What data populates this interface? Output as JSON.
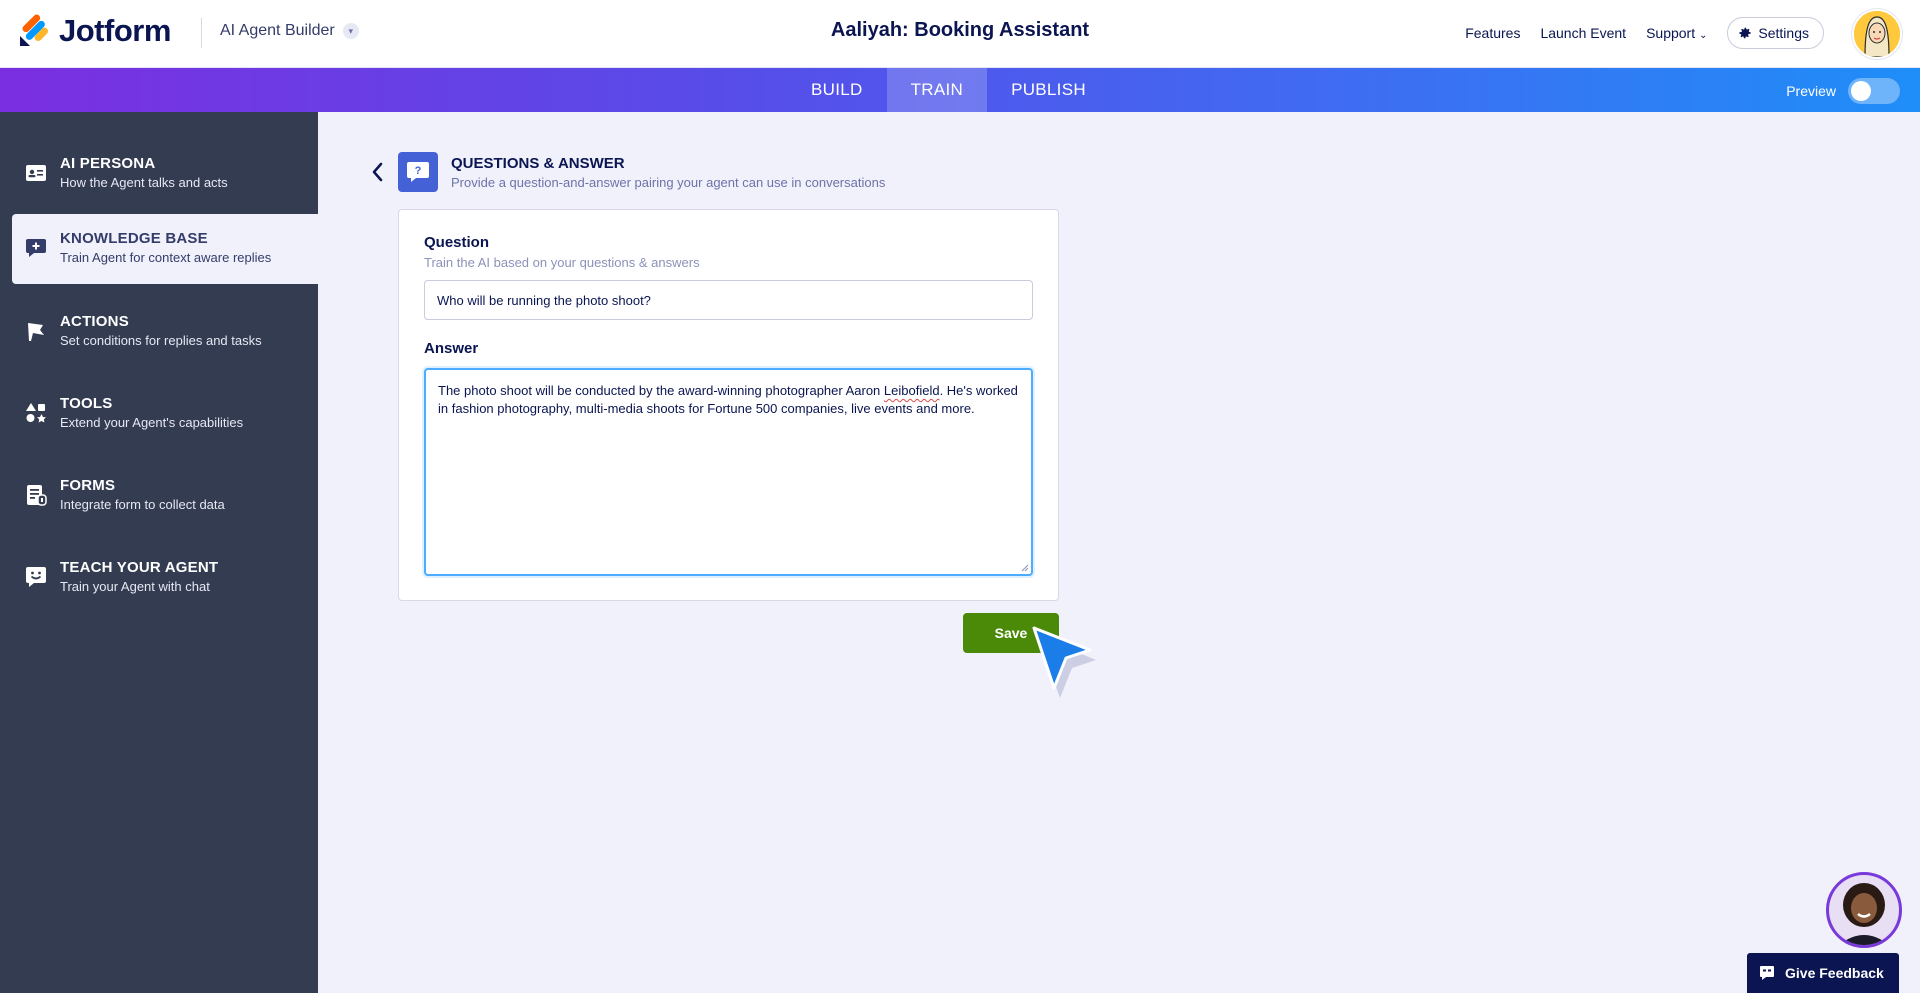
{
  "header": {
    "logo_text": "Jotform",
    "product_name": "AI Agent Builder",
    "agent_title": "Aaliyah: Booking Assistant",
    "links": [
      "Features",
      "Launch Event",
      "Support"
    ],
    "settings_label": "Settings"
  },
  "tabs": {
    "build": "BUILD",
    "train": "TRAIN",
    "publish": "PUBLISH",
    "active": "TRAIN",
    "preview_label": "Preview",
    "preview_on": false
  },
  "sidebar": {
    "items": [
      {
        "title": "AI PERSONA",
        "subtitle": "How the Agent talks and acts",
        "icon": "id-card-icon"
      },
      {
        "title": "KNOWLEDGE BASE",
        "subtitle": "Train Agent for context aware replies",
        "icon": "chat-plus-icon",
        "active": true
      },
      {
        "title": "ACTIONS",
        "subtitle": "Set conditions for replies and tasks",
        "icon": "flag-icon"
      },
      {
        "title": "TOOLS",
        "subtitle": "Extend your Agent's capabilities",
        "icon": "shapes-icon"
      },
      {
        "title": "FORMS",
        "subtitle": "Integrate form to collect data",
        "icon": "form-icon"
      },
      {
        "title": "TEACH YOUR AGENT",
        "subtitle": "Train your Agent with chat",
        "icon": "smiley-chat-icon"
      }
    ]
  },
  "qa": {
    "title": "QUESTIONS & ANSWER",
    "subtitle": "Provide a question-and-answer pairing your agent can use in conversations",
    "question_label": "Question",
    "question_help": "Train the AI based on your questions & answers",
    "question_value": "Who will be running the photo shoot?",
    "answer_label": "Answer",
    "answer_value_before": "The photo shoot will be conducted by the award-winning photographer Aaron ",
    "answer_value_flagged": "Leibofield",
    "answer_value_after": ". He's worked in fashion photography, multi-media shoots for Fortune 500 companies, live events and more.",
    "save_label": "Save"
  },
  "footer": {
    "feedback_label": "Give Feedback"
  },
  "colors": {
    "sidebar_bg": "#343c51",
    "main_bg": "#f1f1fb",
    "save_green": "#4b8a08",
    "focus_blue": "#4dacff",
    "navy": "#0a1551"
  }
}
